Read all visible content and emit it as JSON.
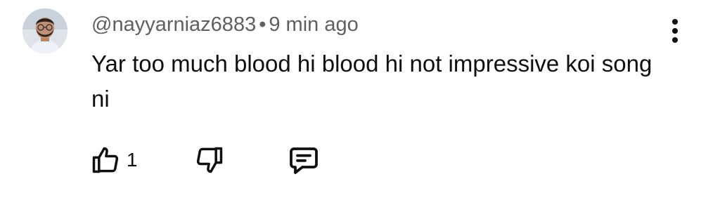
{
  "comment": {
    "author": "@nayyarniaz6883",
    "separator": "•",
    "time": "9 min ago",
    "text": "Yar too much blood hi blood hi not impressive koi song ni",
    "like_count": "1"
  },
  "icons": {
    "avatar": "user-avatar",
    "more": "more-vert-icon",
    "like": "thumb-up-icon",
    "dislike": "thumb-down-icon",
    "reply": "reply-comment-icon"
  },
  "colors": {
    "text": "#0f0f0f",
    "meta": "#606060",
    "background": "#ffffff"
  }
}
